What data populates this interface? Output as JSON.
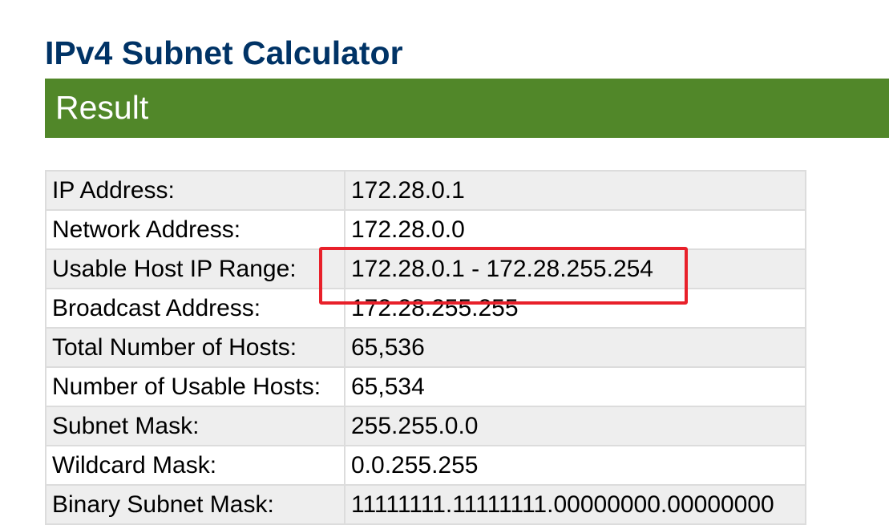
{
  "page": {
    "title": "IPv4 Subnet Calculator"
  },
  "result": {
    "heading": "Result"
  },
  "rows": [
    {
      "label": "IP Address:",
      "value": "172.28.0.1"
    },
    {
      "label": "Network Address:",
      "value": "172.28.0.0"
    },
    {
      "label": "Usable Host IP Range:",
      "value": "172.28.0.1 - 172.28.255.254"
    },
    {
      "label": "Broadcast Address:",
      "value": "172.28.255.255"
    },
    {
      "label": "Total Number of Hosts:",
      "value": "65,536"
    },
    {
      "label": "Number of Usable Hosts:",
      "value": "65,534"
    },
    {
      "label": "Subnet Mask:",
      "value": "255.255.0.0"
    },
    {
      "label": "Wildcard Mask:",
      "value": "0.0.255.255"
    },
    {
      "label": "Binary Subnet Mask:",
      "value": "11111111.11111111.00000000.00000000"
    }
  ],
  "annotation": {
    "highlight_color": "#e8202a"
  },
  "colors": {
    "title": "#003366",
    "banner": "#518729",
    "row_alt": "#eeeeee",
    "border": "#dcdcdc"
  }
}
